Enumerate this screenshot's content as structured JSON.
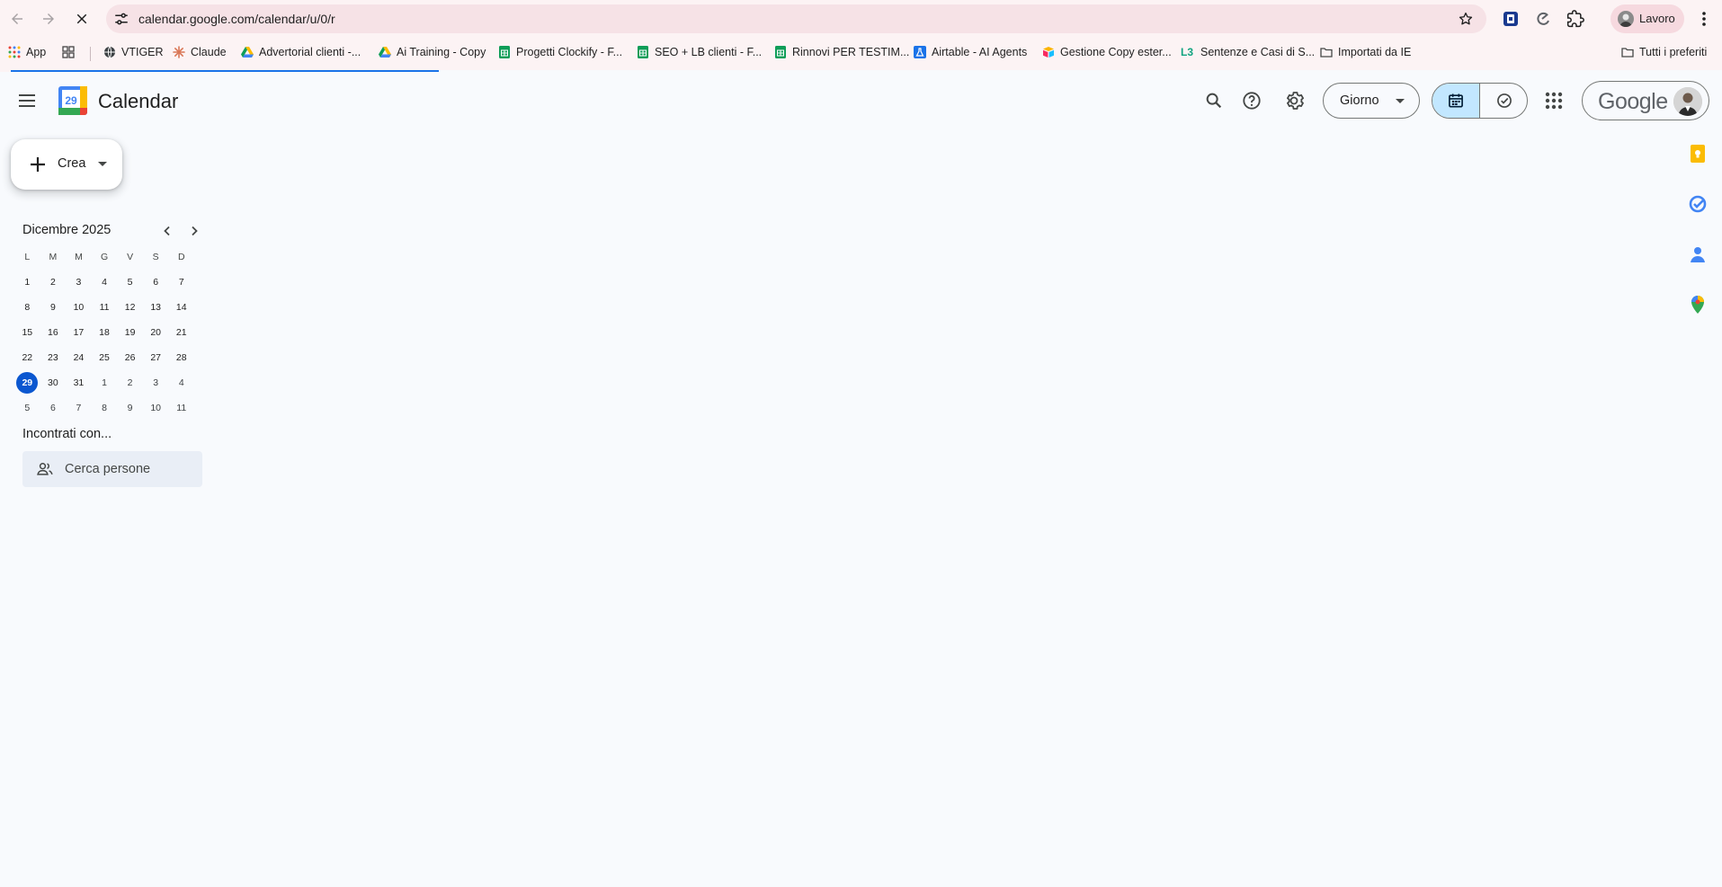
{
  "browser": {
    "url": "calendar.google.com/calendar/u/0/r",
    "profile_label": "Lavoro",
    "bookmarks": [
      {
        "label": "App",
        "icon": "apps-grid-icon"
      },
      {
        "label": "VTIGER",
        "icon": "globe-icon"
      },
      {
        "label": "Claude",
        "icon": "claude-icon"
      },
      {
        "label": "Advertorial clienti -...",
        "icon": "drive-icon"
      },
      {
        "label": "Ai Training - Copy",
        "icon": "drive-icon"
      },
      {
        "label": "Progetti Clockify - F...",
        "icon": "sheets-icon"
      },
      {
        "label": "SEO + LB clienti - F...",
        "icon": "sheets-icon"
      },
      {
        "label": "Rinnovi PER TESTIM...",
        "icon": "sheets-icon"
      },
      {
        "label": "Airtable - AI Agents",
        "icon": "flask-icon"
      },
      {
        "label": "Gestione Copy ester...",
        "icon": "airtable-icon"
      },
      {
        "label": "Sentenze e Casi di S...",
        "icon": "l3-icon"
      },
      {
        "label": "Importati da IE",
        "icon": "folder-icon"
      },
      {
        "label": "Tutti i preferiti",
        "icon": "folder-icon"
      }
    ],
    "l3_badge": "L3"
  },
  "header": {
    "app_title": "Calendar",
    "logo_day": "29",
    "view_label": "Giorno",
    "account_wordmark": "Google"
  },
  "sidebar": {
    "create_label": "Crea",
    "month_title": "Dicembre 2025",
    "weekdays": [
      "L",
      "M",
      "M",
      "G",
      "V",
      "S",
      "D"
    ],
    "weeks": [
      [
        "1",
        "2",
        "3",
        "4",
        "5",
        "6",
        "7"
      ],
      [
        "8",
        "9",
        "10",
        "11",
        "12",
        "13",
        "14"
      ],
      [
        "15",
        "16",
        "17",
        "18",
        "19",
        "20",
        "21"
      ],
      [
        "22",
        "23",
        "24",
        "25",
        "26",
        "27",
        "28"
      ],
      [
        "29",
        "30",
        "31",
        "1",
        "2",
        "3",
        "4"
      ],
      [
        "5",
        "6",
        "7",
        "8",
        "9",
        "10",
        "11"
      ]
    ],
    "today": "29",
    "meet_title": "Incontrati con...",
    "people_placeholder": "Cerca persone"
  },
  "colors": {
    "accent": "#0b57d0",
    "toggle_active": "#c2e7ff",
    "background": "#f8fafd"
  },
  "page_load_progress": 0.25
}
